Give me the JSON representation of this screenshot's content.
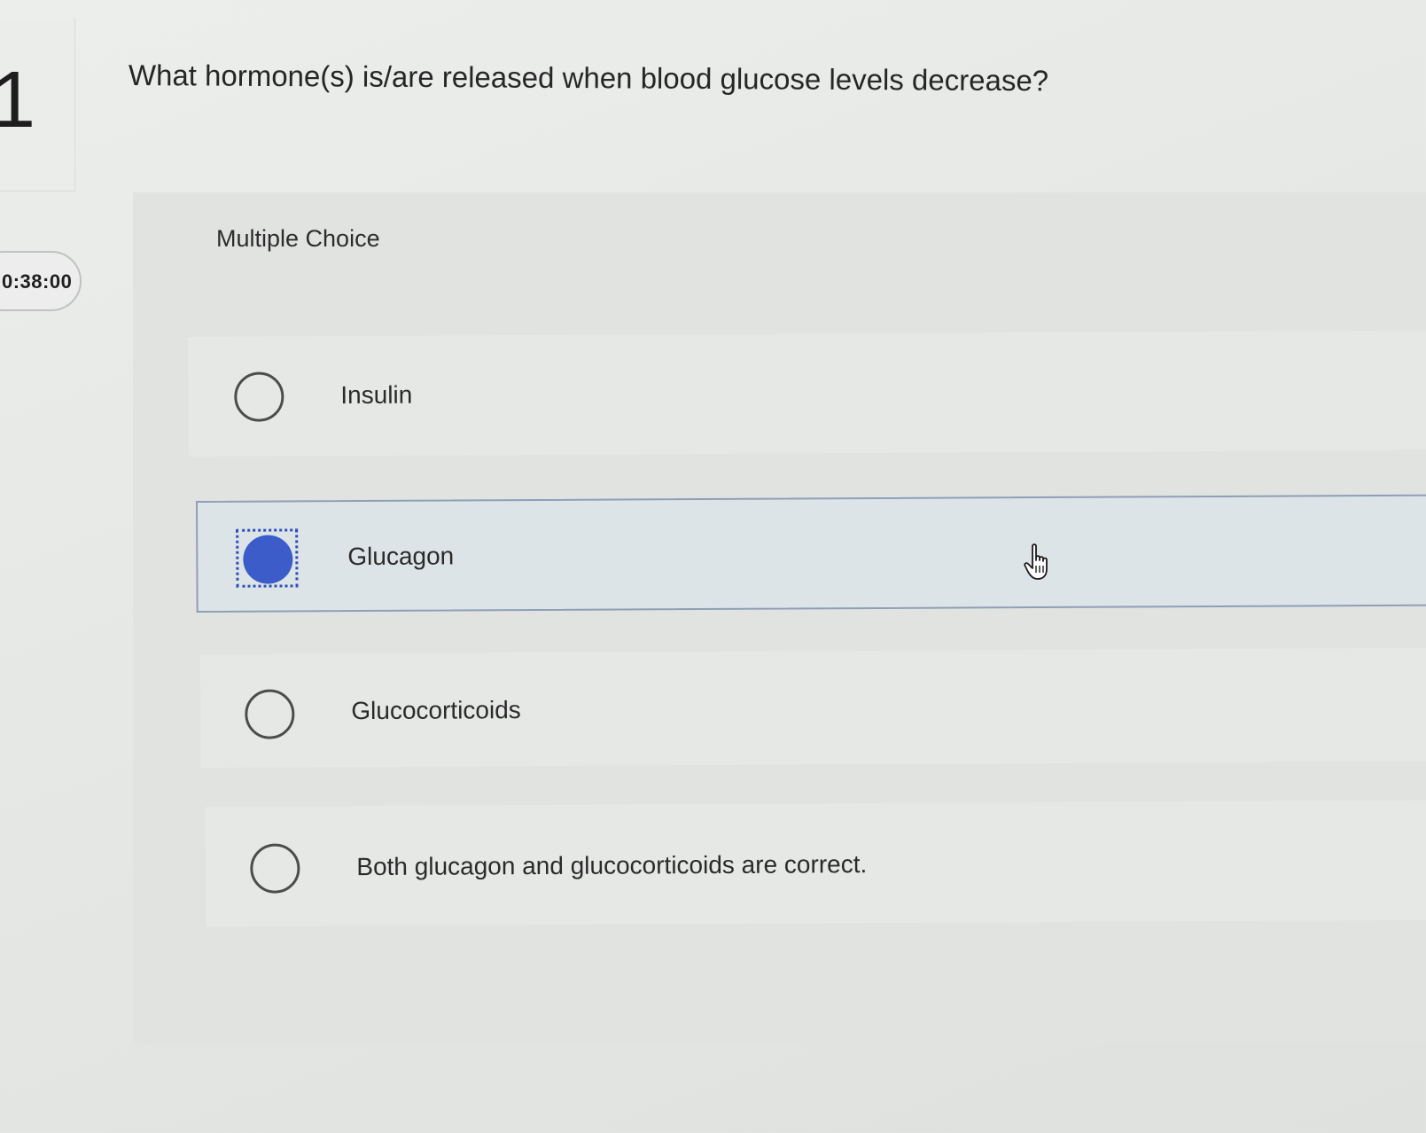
{
  "question": {
    "number": "1",
    "timer": "0:38:00",
    "text": "What hormone(s) is/are released when blood glucose levels decrease?",
    "type_label": "Multiple Choice"
  },
  "options": [
    {
      "label": "Insulin",
      "selected": false
    },
    {
      "label": "Glucagon",
      "selected": true
    },
    {
      "label": "Glucocorticoids",
      "selected": false
    },
    {
      "label": "Both glucagon and glucocorticoids are correct.",
      "selected": false
    }
  ],
  "colors": {
    "selected_fill": "#3b5cc9",
    "selected_row": "#dde4e8",
    "selected_border": "#8e9fb6"
  },
  "icons": {
    "cursor": "hand-pointer-icon"
  }
}
